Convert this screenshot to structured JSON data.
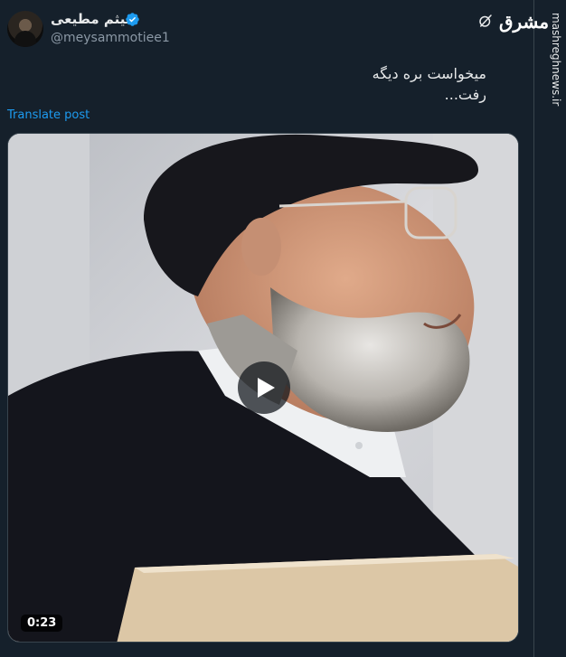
{
  "author": {
    "name": "میثم مطیعی",
    "handle": "@meysammotiee1",
    "verified": true
  },
  "post": {
    "text_line1": "میخواست بره دیگه",
    "text_line2": "رفت...",
    "translate_label": "Translate post"
  },
  "media": {
    "type": "video",
    "duration": "0:23"
  },
  "watermark": {
    "logo": "مشرق",
    "site": "mashreghnews.ir"
  },
  "colors": {
    "background": "#15202b",
    "link": "#1d9bf0",
    "verified": "#1d9bf0",
    "secondary_text": "#8b98a5"
  },
  "icons": [
    "verified-badge-icon",
    "grok-icon",
    "play-icon"
  ]
}
